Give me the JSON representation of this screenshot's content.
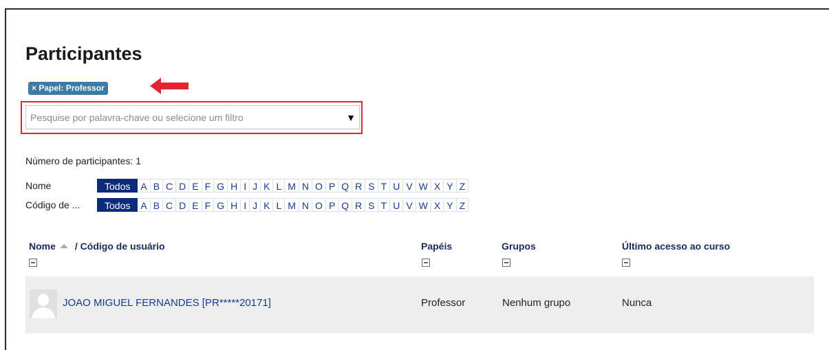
{
  "page": {
    "title": "Participantes"
  },
  "filter": {
    "badge_label": "× Papel: Professor"
  },
  "search": {
    "placeholder": "Pesquise por palavra-chave ou selecione um filtro",
    "dropdown_icon": "▼"
  },
  "participants_count_text": "Número de participantes: 1",
  "initials": {
    "rows": [
      {
        "label": "Nome",
        "all": "Todos"
      },
      {
        "label": "Código de ...",
        "all": "Todos"
      }
    ],
    "letters": [
      "A",
      "B",
      "C",
      "D",
      "E",
      "F",
      "G",
      "H",
      "I",
      "J",
      "K",
      "L",
      "M",
      "N",
      "O",
      "P",
      "Q",
      "R",
      "S",
      "T",
      "U",
      "V",
      "W",
      "X",
      "Y",
      "Z"
    ]
  },
  "table": {
    "headers": {
      "name": "Nome",
      "user_code": "/ Código de usuário",
      "roles": "Papéis",
      "groups": "Grupos",
      "last_access": "Último acesso ao curso"
    },
    "rows": [
      {
        "name": "JOAO MIGUEL FERNANDES [PR*****20171]",
        "role": "Professor",
        "group": "Nenhum grupo",
        "last_access": "Nunca"
      }
    ]
  },
  "colors": {
    "accent": "#0b2b7a",
    "badge": "#3a7ba8",
    "highlight": "#e22631"
  }
}
